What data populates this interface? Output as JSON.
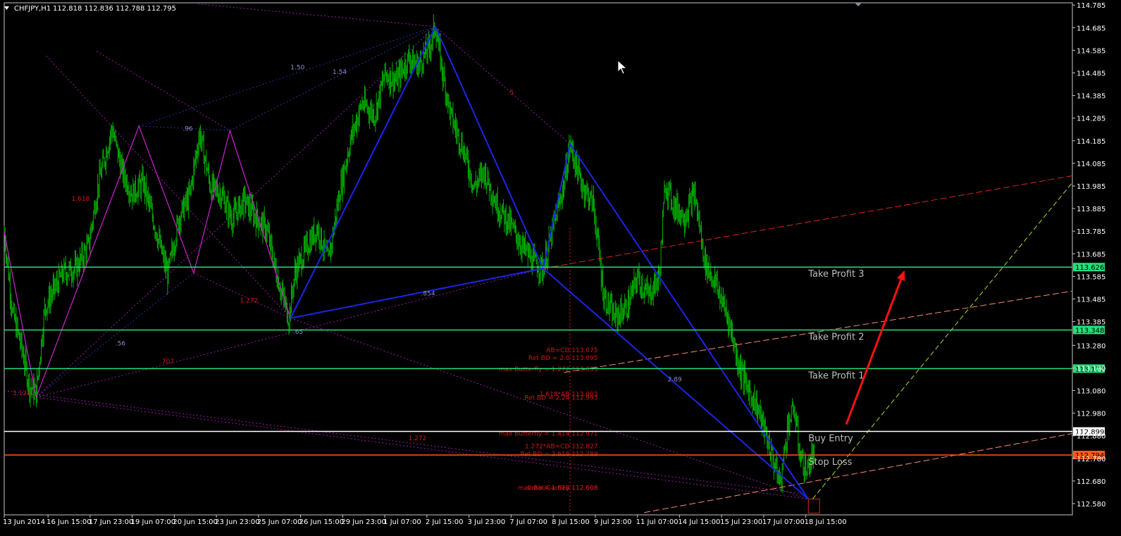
{
  "header": {
    "symbol": "CHFJPY,H1",
    "ohlc": "112.818 112.836 112.788 112.795"
  },
  "colors": {
    "background": "#000000",
    "candles": "#00b000",
    "hline_green": "#22e07a",
    "hline_white": "#ffffff",
    "hline_orange": "#ff5a1a",
    "pattern_blue": "#1c25e6",
    "pattern_magenta": "#d020d0",
    "dotted_purple": "#9a18a8",
    "dotted_blue": "#2630a8",
    "red_dashed": "#e02020",
    "salmon_dashed": "#ff8a70",
    "lime_dashed": "#a8e020",
    "arrow": "#ff1010",
    "text_red": "#d01818"
  },
  "chart_data": {
    "type": "candlestick",
    "y_axis": {
      "min": 112.53,
      "max": 114.795,
      "ticks": [
        "114.785",
        "114.685",
        "114.585",
        "114.485",
        "114.385",
        "114.285",
        "114.185",
        "114.085",
        "113.985",
        "113.885",
        "113.785",
        "113.685",
        "113.585",
        "113.485",
        "113.385",
        "113.280",
        "113.180",
        "113.080",
        "112.980",
        "112.880",
        "112.780",
        "112.680",
        "112.580"
      ]
    },
    "x_axis": {
      "labels": [
        {
          "pos": 0,
          "text": "13 Jun 2014"
        },
        {
          "pos": 52,
          "text": "16 Jun 15:00"
        },
        {
          "pos": 102,
          "text": "17 Jun 23:00"
        },
        {
          "pos": 152,
          "text": "19 Jun 07:00"
        },
        {
          "pos": 202,
          "text": "20 Jun 15:00"
        },
        {
          "pos": 252,
          "text": "23 Jun 23:00"
        },
        {
          "pos": 302,
          "text": "25 Jun 07:00"
        },
        {
          "pos": 352,
          "text": "26 Jun 15:00"
        },
        {
          "pos": 402,
          "text": "29 Jun 23:00"
        },
        {
          "pos": 452,
          "text": "1 Jul 07:00"
        },
        {
          "pos": 502,
          "text": "2 Jul 15:00"
        },
        {
          "pos": 552,
          "text": "3 Jul 23:00"
        },
        {
          "pos": 602,
          "text": "7 Jul 07:00"
        },
        {
          "pos": 652,
          "text": "8 Jul 15:00"
        },
        {
          "pos": 702,
          "text": "9 Jul 23:00"
        },
        {
          "pos": 752,
          "text": "11 Jul 07:00"
        },
        {
          "pos": 802,
          "text": "14 Jul 15:00"
        },
        {
          "pos": 852,
          "text": "15 Jul 23:00"
        },
        {
          "pos": 902,
          "text": "17 Jul 07:00"
        },
        {
          "pos": 952,
          "text": "18 Jul 15:00"
        }
      ],
      "bars_visible": 1000,
      "bars_total": 1210
    },
    "price_path": [
      [
        0,
        113.78
      ],
      [
        10,
        113.42
      ],
      [
        20,
        113.28
      ],
      [
        30,
        113.1
      ],
      [
        38,
        113.07
      ],
      [
        48,
        113.44
      ],
      [
        58,
        113.52
      ],
      [
        70,
        113.6
      ],
      [
        85,
        113.62
      ],
      [
        100,
        113.72
      ],
      [
        112,
        114.0
      ],
      [
        128,
        114.24
      ],
      [
        140,
        114.05
      ],
      [
        152,
        113.95
      ],
      [
        165,
        114.0
      ],
      [
        178,
        113.82
      ],
      [
        194,
        113.59
      ],
      [
        208,
        113.85
      ],
      [
        220,
        113.94
      ],
      [
        232,
        114.22
      ],
      [
        245,
        113.98
      ],
      [
        258,
        113.95
      ],
      [
        270,
        113.84
      ],
      [
        285,
        113.92
      ],
      [
        300,
        113.84
      ],
      [
        312,
        113.79
      ],
      [
        323,
        113.6
      ],
      [
        338,
        113.4
      ],
      [
        345,
        113.6
      ],
      [
        360,
        113.72
      ],
      [
        372,
        113.8
      ],
      [
        385,
        113.65
      ],
      [
        398,
        113.95
      ],
      [
        412,
        114.2
      ],
      [
        425,
        114.35
      ],
      [
        440,
        114.3
      ],
      [
        452,
        114.48
      ],
      [
        466,
        114.45
      ],
      [
        480,
        114.55
      ],
      [
        492,
        114.52
      ],
      [
        505,
        114.6
      ],
      [
        512,
        114.69
      ],
      [
        520,
        114.5
      ],
      [
        530,
        114.3
      ],
      [
        545,
        114.15
      ],
      [
        558,
        113.98
      ],
      [
        570,
        114.05
      ],
      [
        585,
        113.9
      ],
      [
        600,
        113.82
      ],
      [
        615,
        113.72
      ],
      [
        628,
        113.65
      ],
      [
        640,
        113.62
      ],
      [
        652,
        113.8
      ],
      [
        665,
        114.0
      ],
      [
        672,
        114.17
      ],
      [
        685,
        114.0
      ],
      [
        700,
        113.9
      ],
      [
        712,
        113.5
      ],
      [
        725,
        113.4
      ],
      [
        740,
        113.45
      ],
      [
        752,
        113.58
      ],
      [
        765,
        113.5
      ],
      [
        778,
        113.58
      ],
      [
        785,
        114.0
      ],
      [
        795,
        113.9
      ],
      [
        808,
        113.85
      ],
      [
        820,
        113.95
      ],
      [
        832,
        113.65
      ],
      [
        845,
        113.55
      ],
      [
        860,
        113.4
      ],
      [
        872,
        113.2
      ],
      [
        882,
        113.1
      ],
      [
        895,
        113.0
      ],
      [
        905,
        112.88
      ],
      [
        915,
        112.75
      ],
      [
        922,
        112.67
      ],
      [
        930,
        112.92
      ],
      [
        938,
        113.0
      ],
      [
        945,
        112.8
      ],
      [
        952,
        112.72
      ],
      [
        958,
        112.77
      ],
      [
        962,
        112.8
      ]
    ],
    "levels": [
      {
        "name": "Take Profit 3",
        "price": 113.626,
        "badge": "113.626",
        "kind": "green"
      },
      {
        "name": "Take Profit 2",
        "price": 113.348,
        "badge": "113.348",
        "kind": "green"
      },
      {
        "name": "Take Profit 1",
        "price": 113.177,
        "badge": "113.177",
        "kind": "green"
      },
      {
        "name": "Buy Entry",
        "price": 112.899,
        "badge": "112.899",
        "kind": "white"
      },
      {
        "name": "Stop Loss",
        "price": 112.795,
        "badge": "112.794",
        "kind": "orange"
      }
    ],
    "current_price_badge": {
      "text": "112.795",
      "price": 112.795
    },
    "pattern_points": {
      "X": [
        38,
        113.05
      ],
      "A1": [
        160,
        114.25
      ],
      "B1": [
        225,
        113.6
      ],
      "C1": [
        268,
        114.23
      ],
      "D1": [
        340,
        113.4
      ],
      "A2": [
        512,
        114.69
      ],
      "B2": [
        640,
        113.62
      ],
      "C2": [
        672,
        114.17
      ],
      "D2": [
        955,
        112.6
      ]
    },
    "fib_labels": [
      {
        "text": "1.618",
        "at": [
          80,
          113.92
        ],
        "color": "#d01818"
      },
      {
        "text": "1.128",
        "at": [
          10,
          113.06
        ],
        "color": "#d01818"
      },
      {
        "text": ".707",
        "at": [
          185,
          113.2
        ],
        "color": "#d01818"
      },
      {
        "text": "1.272",
        "at": [
          280,
          113.47
        ],
        "color": "#d01818"
      },
      {
        "text": "1.272",
        "at": [
          480,
          112.86
        ],
        "color": "#d01818"
      },
      {
        "text": ".5",
        "at": [
          598,
          114.39
        ],
        "color": "#d01818"
      },
      {
        "text": ".96",
        "at": [
          212,
          114.23
        ],
        "color": "#8a90c8"
      },
      {
        "text": "1.50",
        "at": [
          340,
          114.5
        ],
        "color": "#8a90c8"
      },
      {
        "text": "1.54",
        "at": [
          390,
          114.48
        ],
        "color": "#8a90c8"
      },
      {
        "text": ".56",
        "at": [
          132,
          113.28
        ],
        "color": "#8a90c8"
      },
      {
        "text": ".65",
        "at": [
          343,
          113.33
        ],
        "color": "#8a90c8"
      },
      {
        "text": ".854",
        "at": [
          495,
          113.5
        ],
        "color": "#8a90c8"
      },
      {
        "text": "2.89",
        "at": [
          788,
          113.12
        ],
        "color": "#8a90c8"
      }
    ],
    "projection_labels": [
      {
        "text": "AB=CD  113.075",
        "price": 113.25
      },
      {
        "text": "Ret BD = 2.0  113.095",
        "price": 113.215
      },
      {
        "text": "max Butterfly = 1.272  113.053",
        "price": 113.165
      },
      {
        "text": "1.618*AB  113.003",
        "price": 113.055
      },
      {
        "text": "Ret BD = 2.24  112.993",
        "price": 113.04
      },
      {
        "text": "max Butterfly = 1.414  112.971",
        "price": 112.88
      },
      {
        "text": "1.272*AB=CD  112.827",
        "price": 112.825
      },
      {
        "text": "Ret BD = 2.618  112.789",
        "price": 112.79
      },
      {
        "text": "Crab = 1.618  112.608",
        "price": 112.64
      },
      {
        "text": "max Bat/Gartley  112.608",
        "price": 112.64
      }
    ]
  }
}
